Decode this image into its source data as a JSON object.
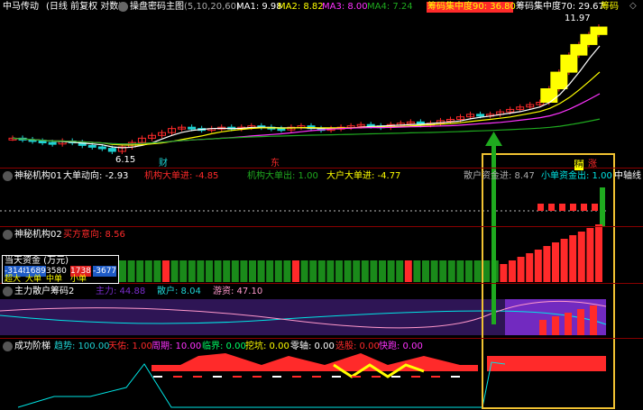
{
  "colors": {
    "background": "#000000",
    "panel_line": "#8a0000",
    "up": "#ff2a2a",
    "down": "#1fd3d3",
    "yellow": "#ffff00",
    "green": "#1faa1f",
    "white": "#ffffff",
    "magenta": "#ff33ff",
    "purple": "#7a2ccc",
    "cyan": "#00e5e5",
    "orange_box": "#f1c232"
  },
  "main_panel": {
    "stock_name": "中马传动",
    "period_label": "(日线 前复权 对数)",
    "indicator_name": "操盘密码主图",
    "indicator_params": "(5,10,20,60)",
    "ma1_label": "MA1: 9.98",
    "ma2_label": "MA2: 8.82",
    "ma3_label": "MA3: 8.00",
    "ma4_label": "MA4: 7.24",
    "chip90_label": "筹码集中度90: 36.80",
    "chip70_label": "筹码集中度70: 29.67",
    "chip_label": "筹码",
    "high_price": "11.97",
    "low_price": "6.15",
    "marker_cai": "财",
    "marker_sell": "东",
    "icon_name": "chevron-right-icon"
  },
  "panel1": {
    "title": "神秘机构01",
    "big_trend": "大单动向: -2.93",
    "inst_buy": "机构大单进: -4.85",
    "inst_sell": "机构大单出: 1.00",
    "big_buy": "大户大单进: -4.77",
    "retail_in": "散户资金进: 8.47",
    "small_out": "小单资金出: 1.00",
    "axis_label": "中轴线",
    "tag_jing": "精",
    "tag_zhang": "涨"
  },
  "panel2": {
    "title": "神秘机构02",
    "direction": "买方意向: 8.56",
    "box_title": "当天资金 (万元)",
    "box_values": [
      "-3148",
      "1689",
      "3580",
      "1738",
      "-3677"
    ],
    "box_labels": [
      "超大",
      "大单",
      "中单",
      "小单"
    ]
  },
  "panel3": {
    "title": "主力散户筹码2",
    "main_force": "主力: 44.88",
    "retail": "散户: 8.04",
    "floating": "游资: 47.10"
  },
  "panel4": {
    "title": "成功阶梯",
    "trend": "趋势: 100.00",
    "heaven": "天佑: 1.00",
    "cycle": "周期: 10.00",
    "border": "临界: 0.00",
    "resist": "挖坑: 0.00",
    "zero_axis": "零轴: 0.00",
    "pick": "选股: 0.00",
    "quick": "快跑: 0.00"
  },
  "chart_data": {
    "type": "candlestick",
    "title": "中马传动 (日线 前复权 对数)",
    "price_high": 11.97,
    "price_low": 6.15,
    "ma": [
      {
        "name": "MA1",
        "value": 9.98
      },
      {
        "name": "MA2",
        "value": 8.82
      },
      {
        "name": "MA3",
        "value": 8.0
      },
      {
        "name": "MA4",
        "value": 7.24
      }
    ],
    "closes": [
      6.6,
      6.55,
      6.5,
      6.45,
      6.4,
      6.5,
      6.45,
      6.35,
      6.3,
      6.25,
      6.15,
      6.3,
      6.45,
      6.6,
      6.7,
      6.8,
      6.95,
      7.0,
      6.95,
      6.9,
      6.95,
      7.0,
      6.95,
      7.0,
      7.05,
      7.0,
      6.95,
      6.9,
      7.0,
      7.05,
      6.95,
      6.9,
      6.95,
      7.0,
      7.05,
      7.1,
      7.05,
      7.0,
      7.1,
      7.15,
      7.2,
      7.1,
      7.15,
      7.25,
      7.3,
      7.4,
      7.5,
      7.45,
      7.5,
      7.6,
      7.7,
      7.8,
      7.9,
      8.0,
      8.6,
      9.4,
      10.3,
      10.9,
      11.5,
      11.97
    ]
  }
}
